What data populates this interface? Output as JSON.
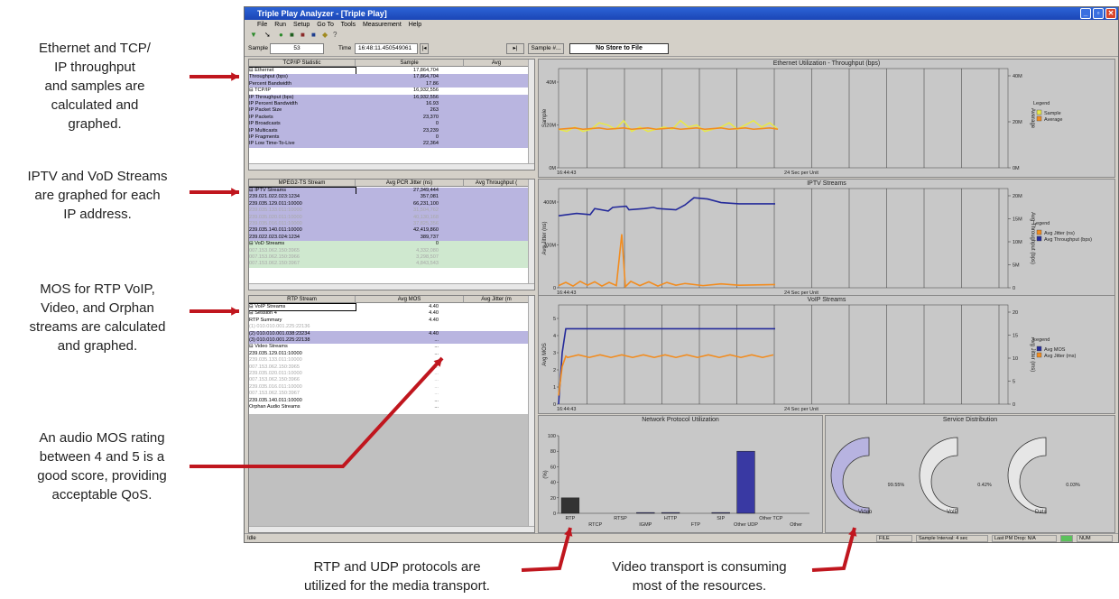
{
  "annotations": {
    "a1": "Ethernet and TCP/\nIP throughput\nand samples are\ncalculated and\ngraphed.",
    "a2": "IPTV and VoD Streams\nare graphed for each\nIP address.",
    "a3": "MOS for RTP VoIP,\nVideo, and Orphan\nstreams are calculated\nand graphed.",
    "a4": "An audio MOS rating\nbetween 4 and 5 is a\ngood score, providing\nacceptable QoS.",
    "a5": "RTP and UDP protocols are\nutilized for the media transport.",
    "a6": "Video transport is consuming\nmost of the resources."
  },
  "window": {
    "title": "Triple Play Analyzer - [Triple Play]",
    "accent": "#1b46b6"
  },
  "menu": [
    "File",
    "Run",
    "Setup",
    "Go To",
    "Tools",
    "Measurement",
    "Help"
  ],
  "statbar": {
    "sample_label": "Sample",
    "sample_value": "53",
    "time_label": "Time",
    "time_value": "16:48:11.450549061",
    "sample_btn": "Sample #...",
    "store": "No Store to File"
  },
  "tcp": {
    "headers": [
      "TCP/IP Statistic",
      "Sample",
      "Avg"
    ],
    "rows": [
      {
        "n": "⊟ Ethernet",
        "v": "17,864,704",
        "hl": false,
        "sel": true
      },
      {
        "n": "Throughput (bps)",
        "v": "17,864,704",
        "hl": true
      },
      {
        "n": "Percent Bandwidth",
        "v": "17.86",
        "hl": true
      },
      {
        "n": "⊟ TCP/IP",
        "v": "16,932,556",
        "hl": false
      },
      {
        "n": "IP Throughput (bps)",
        "v": "16,932,556",
        "hl": true
      },
      {
        "n": "IP Percent Bandwidth",
        "v": "16.93",
        "hl": true
      },
      {
        "n": "IP Packet Size",
        "v": "263",
        "hl": true
      },
      {
        "n": "IP Packets",
        "v": "23,370",
        "hl": true
      },
      {
        "n": "IP Broadcasts",
        "v": "0",
        "hl": true
      },
      {
        "n": "IP Multicasts",
        "v": "23,239",
        "hl": true
      },
      {
        "n": "IP Fragments",
        "v": "0",
        "hl": true
      },
      {
        "n": "IP Low Time-To-Live",
        "v": "22,364",
        "hl": true
      }
    ]
  },
  "mpeg": {
    "headers": [
      "MPEG2-TS Stream",
      "Avg PCR Jitter (ns)",
      "Avg Throughput ("
    ],
    "rows": [
      {
        "n": "⊟ IPTV Streams",
        "v": "27,349,444",
        "hl": true,
        "sel": true
      },
      {
        "n": "239.021.022.023:1234",
        "v": "357,081",
        "hl": true
      },
      {
        "n": "239.035.129.011:10000",
        "v": "66,231,100",
        "hl": true
      },
      {
        "n": "239.035.133.011:10000",
        "v": "31,504,762",
        "hl": true,
        "faded": true
      },
      {
        "n": "239.035.020.011:10000",
        "v": "40,130,168",
        "hl": true,
        "faded": true
      },
      {
        "n": "239.035.016.011:10000",
        "v": "37,825,356",
        "hl": true,
        "faded": true
      },
      {
        "n": "239.035.140.011:10000",
        "v": "42,419,860",
        "hl": true
      },
      {
        "n": "239.022.023.024:1234",
        "v": "389,737",
        "hl": true
      },
      {
        "n": "⊟ VoD Streams",
        "v": "0",
        "hl": false,
        "green": true
      },
      {
        "n": "007.153.062.150:3965",
        "v": "4,332,080",
        "green": true,
        "faded": true
      },
      {
        "n": "007.153.062.150:3966",
        "v": "3,298,507",
        "green": true,
        "faded": true
      },
      {
        "n": "007.153.062.150:3967",
        "v": "4,843,543",
        "green": true,
        "faded": true
      }
    ]
  },
  "rtp": {
    "headers": [
      "RTP Stream",
      "Avg MOS",
      "Avg Jitter (m"
    ],
    "rows": [
      {
        "n": "⊟ VoIP Streams",
        "v": "4.40",
        "sel": true
      },
      {
        "n": "  ⊟ Session 4",
        "v": "4.40"
      },
      {
        "n": "     RTP Summary",
        "v": "4.40"
      },
      {
        "n": "     (1) 010.010.001.225:22136",
        "v": "",
        "faded": true
      },
      {
        "n": "     (2) 010.010.001.038:23234",
        "v": "4.40",
        "hl": true
      },
      {
        "n": "     (3) 010.010.001.225:22138",
        "v": "...",
        "hl": true
      },
      {
        "n": "⊟ Video Streams",
        "v": "..."
      },
      {
        "n": "239.035.129.011:10000",
        "v": "..."
      },
      {
        "n": "239.035.133.011:10000",
        "v": "...",
        "faded": true
      },
      {
        "n": "007.153.062.150:3965",
        "v": "...",
        "faded": true
      },
      {
        "n": "239.035.020.011:10000",
        "v": "...",
        "faded": true
      },
      {
        "n": "007.153.062.150:3966",
        "v": "...",
        "faded": true
      },
      {
        "n": "239.035.016.011:10000",
        "v": "...",
        "faded": true
      },
      {
        "n": "007.153.062.150:3967",
        "v": "...",
        "faded": true
      },
      {
        "n": "239.035.140.011:10000",
        "v": "..."
      },
      {
        "n": "Orphan Audio Streams",
        "v": "..."
      }
    ]
  },
  "graphs": {
    "eth": {
      "title": "Ethernet Utilization - Throughput (bps)",
      "ylabel": "Sample",
      "y2label": "Average",
      "yticks": [
        "40M",
        "20M",
        "0M"
      ],
      "y2ticks": [
        "40M",
        "20M",
        "0M"
      ],
      "start": "16:44:43",
      "unit": "24 Sec per Unit",
      "legend": [
        "Sample",
        "Average"
      ]
    },
    "iptv": {
      "title": "IPTV Streams",
      "ylabel": "Avg Jitter (ns)",
      "y2label": "Avg Throughput (bps)",
      "yticks": [
        "400M",
        "200M",
        "0"
      ],
      "y2ticks": [
        "20M",
        "15M",
        "10M",
        "5M",
        "0"
      ],
      "start": "16:44:43",
      "unit": "24 Sec per Unit",
      "legend": [
        "Avg Jitter (ns)",
        "Avg Throughput (bps)"
      ]
    },
    "voip": {
      "title": "VoIP Streams",
      "ylabel": "Avg MOS",
      "y2label": "Avg Jitter (ms)",
      "yticks": [
        "5",
        "4",
        "3",
        "2",
        "1",
        "0"
      ],
      "y2ticks": [
        "20",
        "15",
        "10",
        "5",
        "0"
      ],
      "start": "16:44:43",
      "unit": "24 Sec per Unit",
      "legend": [
        "Avg MOS",
        "Avg Jitter (ms)"
      ]
    },
    "legend_title": "Legend"
  },
  "chart_data": [
    {
      "type": "bar",
      "title": "Network Protocol Utilization",
      "ylabel": "(%)",
      "ylim": [
        0,
        100
      ],
      "categories": [
        "RTP",
        "RTCP",
        "RTSP",
        "IGMP",
        "HTTP",
        "FTP",
        "SIP",
        "Other UDP",
        "Other TCP",
        "Other"
      ],
      "values": [
        20,
        0,
        0,
        1,
        1,
        0,
        1,
        80,
        0,
        0
      ]
    },
    {
      "type": "pie",
      "title": "Service Distribution",
      "categories": [
        "Video",
        "VoIP",
        "Data"
      ],
      "values": [
        99.55,
        0.42,
        0.03
      ],
      "labels": [
        "99.55%",
        "0.42%",
        "0.03%"
      ]
    }
  ],
  "colors": {
    "sample": "#e8e84a",
    "average": "#f28c1f",
    "throughput": "#242a9a",
    "jitter": "#f28c1f",
    "highlight": "#b9b5e0",
    "green": "#cfe8cf",
    "arrow": "#c0161e"
  },
  "status": {
    "left": "Idle",
    "file": "FILE",
    "interval": "Sample Interval: 4 sec",
    "pm": "Last PM Drop: N/A",
    "num": "NUM"
  }
}
